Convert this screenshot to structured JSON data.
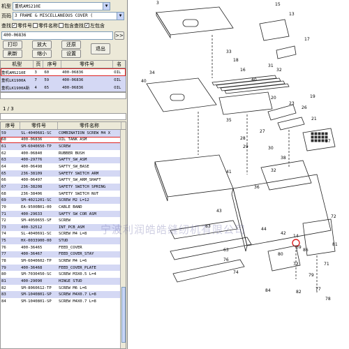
{
  "top": {
    "model_label": "机型",
    "model_value": "重机AMS210E",
    "page_label": "页码",
    "page_value": "3 FRAME & MISCELLANEOUS COVER (",
    "search_label": "查找",
    "search_options": [
      "零件号",
      "零件名称",
      "包含查找",
      "左包含"
    ],
    "part_no_value": "400-06836",
    "go_label": ">>"
  },
  "buttons": {
    "print": "打印",
    "zoom_in": "放大",
    "restore": "还原",
    "refresh": "刷新",
    "zoom_out": "缩小",
    "settings": "设置",
    "exit": "退出"
  },
  "model_table": {
    "headers": [
      "机型",
      "页",
      "序号",
      "零件号",
      "名"
    ],
    "rows": [
      [
        "重机AMS210E",
        "3",
        "60",
        "400-06836",
        "OIL"
      ],
      [
        "重机LK1900A",
        "7",
        "59",
        "400-06836",
        "OIL"
      ],
      [
        "重机LK1900A新",
        "4",
        "65",
        "400-06836",
        "OIL"
      ]
    ],
    "pagination": "1 / 3"
  },
  "parts_table": {
    "headers": [
      "序号",
      "零件号",
      "零件名称"
    ],
    "rows": [
      [
        "59",
        "SL-4040681-SC",
        "COMBINATION SCREW M4 X"
      ],
      [
        "60",
        "400-06836",
        "OIL TANK ASM"
      ],
      [
        "61",
        "SM-6040650-TP",
        "SCREW"
      ],
      [
        "62",
        "400-06840",
        "RUBBER BUSH"
      ],
      [
        "63",
        "400-29776",
        "SAFTY_SW_ASM"
      ],
      [
        "64",
        "400-06498",
        "SAFTY_SW_BASE"
      ],
      [
        "65",
        "236-38109",
        "SAFETY SWITCH ARM"
      ],
      [
        "66",
        "400-06497",
        "SAFTY_SW_ARM_SHAFT"
      ],
      [
        "67",
        "236-38208",
        "SAFETY SWITCH SPRING"
      ],
      [
        "68",
        "236-38406",
        "SAFETY SWITCH NUT"
      ],
      [
        "69",
        "SM-4021201-SC",
        "SCREW M2 L=12"
      ],
      [
        "70",
        "EA-9500B01-00",
        "CABLE BAND"
      ],
      [
        "71",
        "400-29633",
        "SAFTY SW COR ASM"
      ],
      [
        "72",
        "SM-4050655-SF",
        "SCREW"
      ],
      [
        "73",
        "400-32512",
        "INT_PCB_ASM"
      ],
      [
        "74",
        "SL-4040691-SC",
        "SCREW M4 L=8"
      ],
      [
        "75",
        "HX-0033900-00",
        "STUD"
      ],
      [
        "76",
        "400-36465",
        "FEED_COVER"
      ],
      [
        "77",
        "400-36467",
        "FEED_COVER_STAY"
      ],
      [
        "78",
        "SM-6040602-TP",
        "SCREW M4 L=6"
      ],
      [
        "79",
        "400-36468",
        "FEED_COVER_PLATE"
      ],
      [
        "80",
        "SM-7030450-SC",
        "SCREW M3X0.5 L=4"
      ],
      [
        "81",
        "400-29090",
        "HINGE STUD"
      ],
      [
        "82",
        "SM-8060612-TP",
        "SCREW M6 L=6"
      ],
      [
        "83",
        "SM-1040801-SP",
        "SCREW M4X0.7 L=8"
      ],
      [
        "84",
        "SM-1040801-SP",
        "SCREW M4X0.7 L=8"
      ]
    ]
  },
  "diagram": {
    "callouts": [
      "3",
      "15",
      "13",
      "17",
      "33",
      "18",
      "16",
      "31",
      "32",
      "40",
      "34",
      "40",
      "19",
      "21",
      "20",
      "23",
      "26",
      "35",
      "37",
      "27",
      "28",
      "29",
      "30",
      "38",
      "32",
      "72",
      "36",
      "41",
      "43",
      "44",
      "42",
      "14",
      "39",
      "86",
      "81",
      "80",
      "71",
      "73",
      "79",
      "77",
      "82",
      "84",
      "78",
      "83",
      "76",
      "74",
      "63"
    ],
    "watermark": "宁波利润皓皓缝纫机有限公司"
  }
}
